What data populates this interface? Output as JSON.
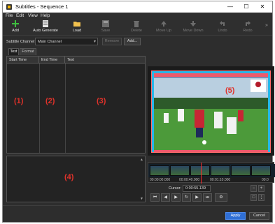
{
  "window": {
    "title": "Subtitles - Sequence 1"
  },
  "menu": [
    "File",
    "Edit",
    "View",
    "Help"
  ],
  "toolbar": {
    "add": "Add",
    "auto_generate": "Auto Generate",
    "load": "Load",
    "save": "Save",
    "delete": "Delete",
    "move_up": "Move Up",
    "move_down": "Move Down",
    "undo": "Undo",
    "redo": "Redo"
  },
  "channel": {
    "label": "Subtitle Channel:",
    "selected": "Main Channel",
    "remove": "Remove",
    "add": "Add..."
  },
  "tabs": [
    "Text",
    "Format"
  ],
  "table": {
    "columns": [
      "Start Time",
      "End Time",
      "Text"
    ],
    "callouts": [
      "(1)",
      "(2)",
      "(3)"
    ]
  },
  "editor": {
    "callout": "(4)"
  },
  "preview": {
    "callout": "(5)"
  },
  "timeline": {
    "timecodes": [
      "00:00:00.000",
      "00:00:40.000",
      "00:01:10.000",
      "00:0"
    ]
  },
  "cursor": {
    "label": "Cursor:",
    "value": "0:00:55.139"
  },
  "footer": {
    "apply": "Apply",
    "cancel": "Cancel"
  },
  "colors": {
    "accent_blue": "#2f6fd6",
    "preview_bg": "#29b6e8",
    "preview_band": "#ee5a6c",
    "callout_red": "#e0322a",
    "playhead": "#ff2a2a"
  },
  "icons": {
    "add": "plus-icon",
    "auto_generate": "auto-generate-icon",
    "load": "folder-icon",
    "save": "save-icon",
    "delete": "delete-icon",
    "move_up": "move-up-icon",
    "move_down": "move-down-icon",
    "undo": "undo-icon",
    "redo": "redo-icon"
  }
}
